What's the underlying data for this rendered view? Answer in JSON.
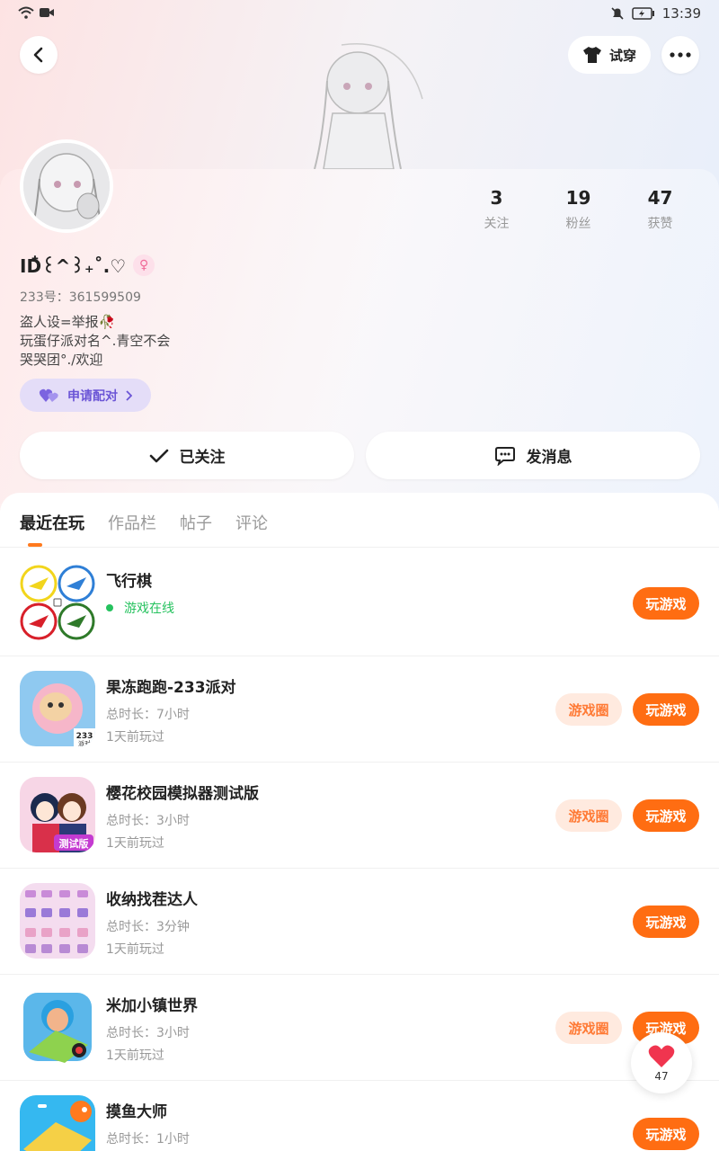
{
  "status_bar": {
    "time": "13:39"
  },
  "header": {
    "try_on_label": "试穿"
  },
  "profile": {
    "nickname": "ID໋꒰^꒱₊˚.♡",
    "gender_symbol": "♀",
    "uid": "233号：361599509",
    "bio_lines": [
      "盗人设=举报🥀",
      "玩蛋仔派对名^.青空不会",
      "哭哭团°./欢迎"
    ],
    "pair_label": "申请配对",
    "stats": [
      {
        "value": "3",
        "label": "关注"
      },
      {
        "value": "19",
        "label": "粉丝"
      },
      {
        "value": "47",
        "label": "获赞"
      }
    ],
    "follow_label": "已关注",
    "message_label": "发消息"
  },
  "tabs": [
    "最近在玩",
    "作品栏",
    "帖子",
    "评论"
  ],
  "games": [
    {
      "title": "飞行棋",
      "online_text": "游戏在线",
      "play_label": "玩游戏"
    },
    {
      "title": "果冻跑跑-233派对",
      "duration": "总时长：7小时",
      "last_played": "1天前玩过",
      "circle_label": "游戏圈",
      "play_label": "玩游戏",
      "badge": "233派对"
    },
    {
      "title": "樱花校园模拟器测试版",
      "duration": "总时长：3小时",
      "last_played": "1天前玩过",
      "circle_label": "游戏圈",
      "play_label": "玩游戏",
      "badge": "测试版"
    },
    {
      "title": "收纳找茬达人",
      "duration": "总时长：3分钟",
      "last_played": "1天前玩过",
      "play_label": "玩游戏"
    },
    {
      "title": "米加小镇世界",
      "duration": "总时长：3小时",
      "last_played": "1天前玩过",
      "circle_label": "游戏圈",
      "play_label": "玩游戏"
    },
    {
      "title": "摸鱼大师",
      "duration": "总时长：1小时",
      "play_label": "玩游戏"
    }
  ],
  "like_float": {
    "count": "47"
  },
  "colors": {
    "accent": "#ff6d12",
    "online": "#25c25e",
    "pair": "#6b55d6"
  }
}
